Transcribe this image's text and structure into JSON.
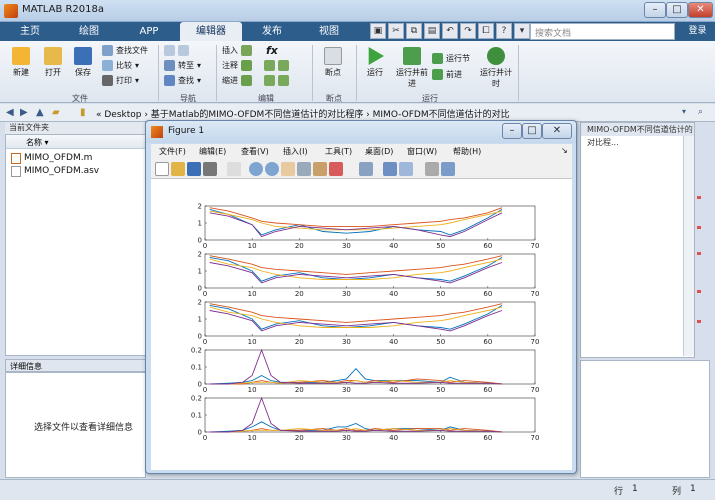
{
  "app": {
    "title": "MATLAB R2018a"
  },
  "tabs": [
    "主页",
    "绘图",
    "APP",
    "编辑器",
    "发布",
    "视图"
  ],
  "active_tab": "编辑器",
  "search": {
    "placeholder": "搜索文档"
  },
  "login": "登录",
  "ribbon": {
    "file": {
      "group": "文件",
      "new": "新建",
      "open": "打开",
      "save": "保存",
      "find_files": "查找文件",
      "compare": "比较",
      "print": "打印"
    },
    "navigate": {
      "group": "导航",
      "goto": "转至",
      "find": "查找"
    },
    "edit": {
      "group": "编辑",
      "insert": "插入",
      "comment": "注释",
      "indent": "缩进",
      "fx": "fx"
    },
    "breakpoints": {
      "group": "断点",
      "label": "断点"
    },
    "run": {
      "group": "运行",
      "run": "运行",
      "run_advance": "运行并前进",
      "run_section": "运行节",
      "advance": "前进",
      "run_time": "运行并计时"
    }
  },
  "address": {
    "path": "« Desktop  ›  基于Matlab的MIMO-OFDM不同信道估计的对比程序  ›  MIMO-OFDM不同信道估计的对比"
  },
  "current_folder": {
    "header": "当前文件夹",
    "column": "名称 ▾",
    "files": [
      "MIMO_OFDM.m",
      "MIMO_OFDM.asv"
    ]
  },
  "details": {
    "header": "详细信息",
    "message": "选择文件以查看详细信息"
  },
  "right_panel": {
    "header": "MIMO-OFDM不同信道估计的对比程..."
  },
  "status": {
    "row_label": "行",
    "row": "1",
    "col_label": "列",
    "col": "1"
  },
  "figure": {
    "title": "Figure 1",
    "menu": [
      "文件(F)",
      "编辑(E)",
      "查看(V)",
      "插入(I)",
      "工具(T)",
      "桌面(D)",
      "窗口(W)",
      "帮助(H)"
    ],
    "colors": {
      "blue": "#0072bd",
      "orange": "#d95319",
      "yellow": "#edb120",
      "purple": "#7e2f8e"
    }
  },
  "chart_data": [
    {
      "type": "line",
      "xlim": [
        0,
        70
      ],
      "ylim": [
        0,
        2
      ],
      "xticks": [
        0,
        10,
        20,
        30,
        40,
        50,
        60,
        70
      ],
      "yticks": [
        0,
        1,
        2
      ],
      "x": [
        1,
        5,
        10,
        12,
        15,
        20,
        25,
        30,
        35,
        40,
        45,
        50,
        52,
        55,
        60,
        63
      ],
      "series": [
        {
          "values": [
            1.8,
            1.5,
            0.9,
            0.3,
            0.6,
            0.9,
            0.5,
            0.4,
            0.5,
            0.8,
            0.6,
            0.5,
            0.3,
            0.6,
            1.3,
            1.8
          ]
        },
        {
          "values": [
            1.9,
            1.7,
            1.3,
            1.1,
            1.0,
            0.9,
            0.8,
            0.8,
            0.8,
            0.9,
            1.0,
            1.1,
            1.2,
            1.3,
            1.6,
            1.9
          ]
        },
        {
          "values": [
            1.7,
            1.5,
            1.2,
            1.0,
            0.8,
            0.7,
            0.6,
            0.6,
            0.6,
            0.7,
            0.8,
            0.9,
            1.0,
            1.2,
            1.5,
            1.7
          ]
        },
        {
          "values": [
            1.6,
            1.4,
            0.9,
            0.2,
            0.5,
            0.8,
            0.7,
            0.6,
            0.7,
            0.8,
            0.6,
            0.3,
            0.2,
            0.5,
            1.2,
            1.6
          ]
        }
      ]
    },
    {
      "type": "line",
      "xlim": [
        0,
        70
      ],
      "ylim": [
        0,
        2
      ],
      "xticks": [
        0,
        10,
        20,
        30,
        40,
        50,
        60,
        70
      ],
      "yticks": [
        0,
        1,
        2
      ],
      "x": [
        1,
        5,
        10,
        12,
        15,
        20,
        25,
        30,
        35,
        40,
        45,
        50,
        52,
        55,
        60,
        63
      ],
      "series": [
        {
          "values": [
            1.8,
            1.6,
            1.0,
            0.4,
            0.7,
            0.9,
            0.6,
            0.5,
            0.6,
            0.8,
            0.6,
            0.5,
            0.4,
            0.7,
            1.3,
            1.8
          ]
        },
        {
          "values": [
            1.9,
            1.7,
            1.4,
            1.2,
            1.1,
            1.0,
            0.9,
            0.8,
            0.9,
            1.0,
            1.1,
            1.2,
            1.3,
            1.4,
            1.7,
            1.9
          ]
        },
        {
          "values": [
            1.7,
            1.4,
            1.2,
            1.0,
            0.8,
            0.6,
            0.5,
            0.5,
            0.5,
            0.6,
            0.8,
            0.9,
            1.0,
            1.2,
            1.5,
            1.7
          ]
        },
        {
          "values": [
            1.5,
            1.3,
            0.9,
            0.3,
            0.6,
            0.8,
            0.7,
            0.6,
            0.7,
            0.8,
            0.6,
            0.4,
            0.3,
            0.6,
            1.2,
            1.5
          ]
        }
      ]
    },
    {
      "type": "line",
      "xlim": [
        0,
        70
      ],
      "ylim": [
        0,
        2
      ],
      "xticks": [
        0,
        10,
        20,
        30,
        40,
        50,
        60,
        70
      ],
      "yticks": [
        0,
        1,
        2
      ],
      "x": [
        1,
        5,
        10,
        12,
        15,
        20,
        25,
        30,
        35,
        40,
        45,
        50,
        52,
        55,
        60,
        63
      ],
      "series": [
        {
          "values": [
            1.8,
            1.6,
            1.0,
            0.4,
            0.7,
            0.9,
            0.6,
            0.5,
            0.6,
            0.8,
            0.6,
            0.5,
            0.4,
            0.7,
            1.3,
            1.8
          ]
        },
        {
          "values": [
            1.9,
            1.7,
            1.4,
            1.2,
            1.1,
            1.0,
            0.9,
            0.8,
            0.9,
            1.0,
            1.1,
            1.2,
            1.3,
            1.4,
            1.7,
            1.9
          ]
        },
        {
          "values": [
            1.7,
            1.4,
            1.2,
            1.0,
            0.8,
            0.6,
            0.5,
            0.5,
            0.5,
            0.6,
            0.8,
            0.9,
            1.0,
            1.2,
            1.5,
            1.7
          ]
        },
        {
          "values": [
            1.5,
            1.3,
            0.9,
            0.3,
            0.6,
            0.8,
            0.7,
            0.6,
            0.7,
            0.8,
            0.6,
            0.4,
            0.3,
            0.6,
            1.2,
            1.5
          ]
        }
      ]
    },
    {
      "type": "line",
      "xlim": [
        0,
        70
      ],
      "ylim": [
        0,
        0.2
      ],
      "xticks": [
        0,
        10,
        20,
        30,
        40,
        50,
        60,
        70
      ],
      "yticks": [
        0,
        0.1,
        0.2
      ],
      "x": [
        1,
        5,
        8,
        10,
        12,
        14,
        16,
        20,
        25,
        28,
        30,
        32,
        34,
        36,
        40,
        45,
        50,
        52,
        55,
        60,
        63
      ],
      "series": [
        {
          "values": [
            0.0,
            0.005,
            0.01,
            0.02,
            0.05,
            0.02,
            0.01,
            0.01,
            0.01,
            0.02,
            0.03,
            0.09,
            0.03,
            0.02,
            0.02,
            0.02,
            0.01,
            0.04,
            0.01,
            0.005,
            0.0
          ]
        },
        {
          "values": [
            0.0,
            0.0,
            0.0,
            0.01,
            0.02,
            0.01,
            0.005,
            0.01,
            0.02,
            0.01,
            0.02,
            0.02,
            0.01,
            0.02,
            0.01,
            0.03,
            0.02,
            0.01,
            0.02,
            0.01,
            0.0
          ]
        },
        {
          "values": [
            0.0,
            0.0,
            0.005,
            0.01,
            0.01,
            0.01,
            0.005,
            0.02,
            0.01,
            0.01,
            0.01,
            0.02,
            0.01,
            0.01,
            0.02,
            0.01,
            0.01,
            0.02,
            0.01,
            0.005,
            0.0
          ]
        },
        {
          "values": [
            0.0,
            0.0,
            0.01,
            0.05,
            0.2,
            0.05,
            0.01,
            0.005,
            0.005,
            0.005,
            0.01,
            0.005,
            0.005,
            0.01,
            0.005,
            0.005,
            0.01,
            0.005,
            0.005,
            0.005,
            0.0
          ]
        }
      ]
    },
    {
      "type": "line",
      "xlim": [
        0,
        70
      ],
      "ylim": [
        0,
        0.2
      ],
      "xticks": [
        0,
        10,
        20,
        30,
        40,
        50,
        60,
        70
      ],
      "yticks": [
        0,
        0.1,
        0.2
      ],
      "x": [
        1,
        5,
        8,
        10,
        12,
        14,
        16,
        20,
        25,
        28,
        30,
        32,
        34,
        36,
        40,
        45,
        50,
        52,
        55,
        60,
        63
      ],
      "series": [
        {
          "values": [
            0.0,
            0.005,
            0.01,
            0.03,
            0.06,
            0.03,
            0.01,
            0.01,
            0.01,
            0.03,
            0.03,
            0.05,
            0.02,
            0.01,
            0.02,
            0.02,
            0.01,
            0.03,
            0.01,
            0.005,
            0.0
          ]
        },
        {
          "values": [
            0.0,
            0.0,
            0.005,
            0.01,
            0.02,
            0.01,
            0.01,
            0.01,
            0.02,
            0.01,
            0.02,
            0.01,
            0.01,
            0.02,
            0.01,
            0.02,
            0.02,
            0.01,
            0.02,
            0.01,
            0.0
          ]
        },
        {
          "values": [
            0.0,
            0.0,
            0.005,
            0.01,
            0.01,
            0.01,
            0.01,
            0.02,
            0.01,
            0.01,
            0.01,
            0.02,
            0.01,
            0.01,
            0.02,
            0.01,
            0.01,
            0.02,
            0.01,
            0.005,
            0.0
          ]
        },
        {
          "values": [
            0.0,
            0.0,
            0.01,
            0.05,
            0.2,
            0.05,
            0.01,
            0.005,
            0.005,
            0.005,
            0.01,
            0.005,
            0.005,
            0.01,
            0.005,
            0.005,
            0.01,
            0.005,
            0.005,
            0.005,
            0.0
          ]
        }
      ]
    }
  ]
}
